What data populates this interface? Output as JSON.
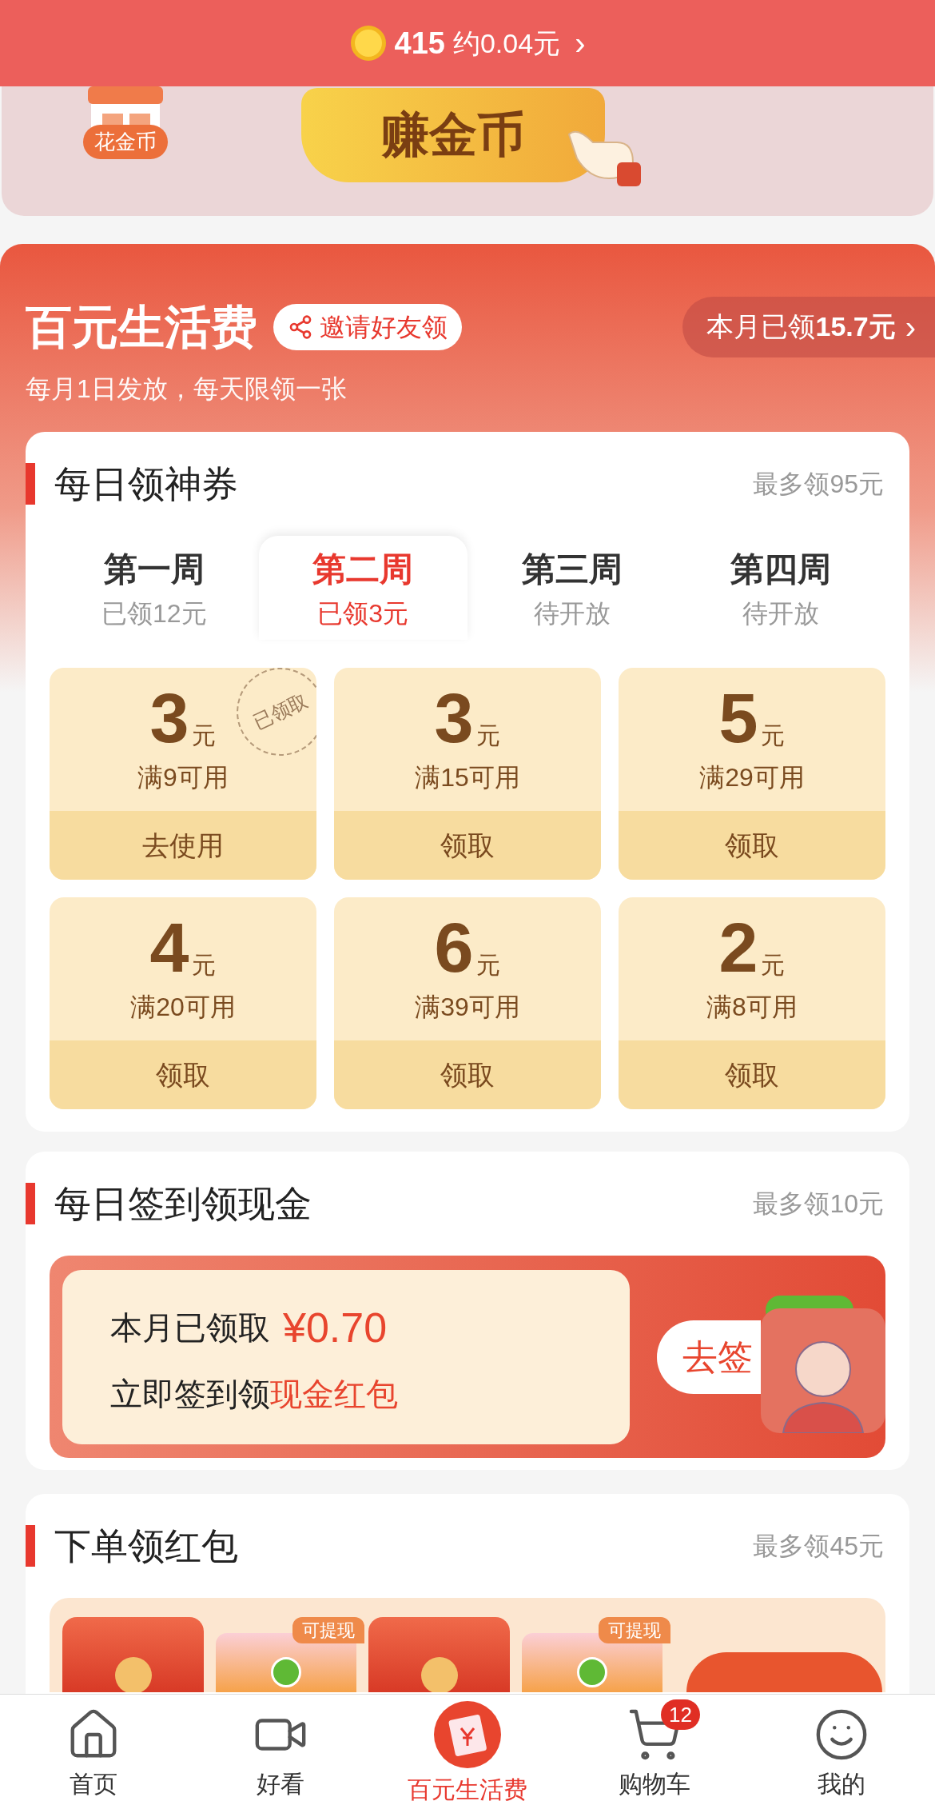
{
  "header": {
    "coins": "415",
    "approx": "约0.04元",
    "chevron": "›"
  },
  "banner": {
    "spend_label": "花金币",
    "earn_button": "赚金币"
  },
  "hero": {
    "title": "百元生活费",
    "invite_button": "邀请好友领",
    "month_label": "本月已领",
    "month_amount": "15.7元",
    "month_chevron": "›",
    "subtitle": "每月1日发放，每天限领一张"
  },
  "coupons": {
    "title": "每日领神券",
    "max": "最多领95元",
    "weeks": [
      {
        "label": "第一周",
        "status": "已领12元",
        "selected": false
      },
      {
        "label": "第二周",
        "status": "已领3元",
        "selected": true
      },
      {
        "label": "第三周",
        "status": "待开放",
        "selected": false
      },
      {
        "label": "第四周",
        "status": "待开放",
        "selected": false
      }
    ],
    "items": [
      {
        "amount": "3",
        "unit": "元",
        "condition": "满9可用",
        "action": "去使用",
        "claimed": true,
        "stamp": "已领取"
      },
      {
        "amount": "3",
        "unit": "元",
        "condition": "满15可用",
        "action": "领取",
        "claimed": false
      },
      {
        "amount": "5",
        "unit": "元",
        "condition": "满29可用",
        "action": "领取",
        "claimed": false
      },
      {
        "amount": "4",
        "unit": "元",
        "condition": "满20可用",
        "action": "领取",
        "claimed": false
      },
      {
        "amount": "6",
        "unit": "元",
        "condition": "满39可用",
        "action": "领取",
        "claimed": false
      },
      {
        "amount": "2",
        "unit": "元",
        "condition": "满8可用",
        "action": "领取",
        "claimed": false
      }
    ]
  },
  "checkin": {
    "title": "每日签到领现金",
    "max": "最多领10元",
    "claimed_label": "本月已领取",
    "claimed_amount": "¥0.70",
    "line2_prefix": "立即签到领",
    "line2_highlight": "现金红包",
    "button": "去签"
  },
  "orders": {
    "title": "下单领红包",
    "max": "最多领45元",
    "envelopes": [
      {
        "kind": "red"
      },
      {
        "kind": "cash",
        "tag": "可提现"
      },
      {
        "kind": "red"
      },
      {
        "kind": "cash",
        "tag": "可提现"
      }
    ]
  },
  "nav": [
    {
      "label": "首页",
      "selected": false
    },
    {
      "label": "好看",
      "selected": false
    },
    {
      "label": "百元生活费",
      "selected": true
    },
    {
      "label": "购物车",
      "selected": false,
      "badge": "12"
    },
    {
      "label": "我的",
      "selected": false
    }
  ]
}
